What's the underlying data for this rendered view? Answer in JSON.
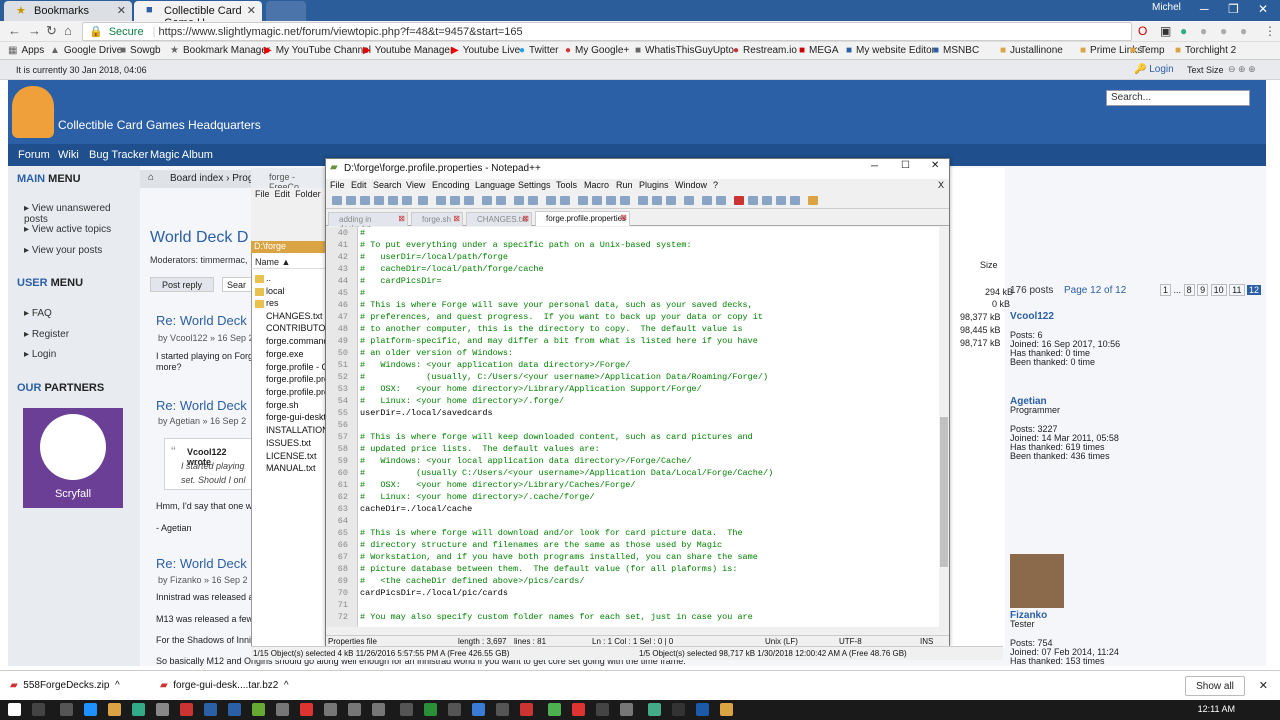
{
  "browser": {
    "tabs": [
      {
        "label": "Bookmarks"
      },
      {
        "label": "Collectible Card Game H"
      }
    ],
    "user": "Michel",
    "url": "https://www.slightlymagic.net/forum/viewtopic.php?f=48&t=9457&start=165",
    "secure_label": "Secure"
  },
  "bookmarks": [
    "Apps",
    "Google Drive",
    "Sowgb",
    "Bookmark Manager",
    "My YouTube Channel",
    "Youtube Manager",
    "Youtube Live",
    "Twitter",
    "My Google+",
    "WhatisThisGuyUpto",
    "Restream.io",
    "MEGA",
    "My website Editor",
    "MSNBC",
    "Justallinone",
    "Prime Links",
    "Temp",
    "Torchlight 2"
  ],
  "forum": {
    "date_line": "It is currently 30 Jan 2018, 04:06",
    "login": "Login",
    "text_size": "Text Size",
    "site_title": "Collectible Card Games Headquarters",
    "search_placeholder": "Search...",
    "nav": [
      "Forum",
      "Wiki",
      "Bug Tracker",
      "Magic Album"
    ],
    "main_menu_title_a": "MAIN",
    "main_menu_title_b": " MENU",
    "main_menu": [
      "View unanswered posts",
      "View active topics",
      "View your posts"
    ],
    "user_menu_title_a": "USER",
    "user_menu_title_b": " MENU",
    "user_menu": [
      "FAQ",
      "Register",
      "Login"
    ],
    "partners_title_a": "OUR",
    "partners_title_b": " PARTNERS",
    "scryfall": "Scryfall",
    "breadcrumb": "Board index",
    "breadcrumb_tail": "Prog",
    "topic_title": "World Deck D",
    "moderators": "Moderators: timmermac,",
    "post_reply": "Post reply",
    "search_short": "Sear",
    "posts_count": "176 posts",
    "pagination": "Page 12 of 12",
    "pages": [
      "1",
      "...",
      "8",
      "9",
      "10",
      "11",
      "12"
    ],
    "posts": [
      {
        "title": "Re: World Deck",
        "meta": "by Vcool122 » 16 Sep 2",
        "body1": "I started playing on Forge",
        "body2": "more?"
      },
      {
        "title": "Re: World Deck D",
        "meta": "by Agetian » 16 Sep 2",
        "quote_author": "Vcool122 wrote",
        "quote1": "I started playing",
        "quote2": "set. Should I onl",
        "body1": "Hmm, I'd say that one will",
        "body2": "- Agetian"
      },
      {
        "title": "Re: World Deck D",
        "meta": "by Fizanko » 16 Sep 2",
        "body1": "Innistrad was released a c",
        "body2": "M13 was released a few m",
        "body3": "For the Shadows of Innistr",
        "body4": "So basically M12 and Origins should go along well enough for an innistrad world if you want to get core set going with the time frame."
      }
    ],
    "users": [
      {
        "name": "Vcool122",
        "rank": "",
        "posts": "Posts: 6",
        "joined": "Joined: 16 Sep 2017, 10:56",
        "thanked": "Has thanked: 0 time",
        "been": "Been thanked: 0 time"
      },
      {
        "name": "Agetian",
        "rank": "Programmer",
        "posts": "Posts: 3227",
        "joined": "Joined: 14 Mar 2011, 05:58",
        "thanked": "Has thanked: 619 times",
        "been": "Been thanked: 436 times"
      },
      {
        "name": "Fizanko",
        "rank": "Tester",
        "posts": "Posts: 754",
        "joined": "Joined: 07 Feb 2014, 11:24",
        "thanked": "Has thanked: 153 times"
      }
    ]
  },
  "explorer": {
    "title": "forge - FreeCo",
    "menu": [
      "File",
      "Edit",
      "Folder"
    ],
    "path": "D:\\forge",
    "col_name": "Name",
    "col_size": "Size",
    "files": [
      "..",
      "local",
      "res",
      "CHANGES.txt",
      "CONTRIBUTOR",
      "forge.command",
      "forge.exe",
      "forge.profile - C",
      "forge.profile.pro",
      "forge.profile.pro",
      "forge.sh",
      "forge-gui-deskto",
      "INSTALLATION",
      "ISSUES.txt",
      "LICENSE.txt",
      "MANUAL.txt"
    ],
    "sizes": [
      "294 kB",
      "0 kB",
      "98,377 kB",
      "98,445 kB",
      "98,717 kB"
    ],
    "status_left": "1/15 Object(s) selected   4 kB  11/26/2016 5:57:55 PM  A   (Free 426.55 GB)",
    "status_right": "1/5 Object(s) selected   98,717 kB  1/30/2018 12:00:42 AM  A   (Free 48.76 GB)"
  },
  "notepad": {
    "title": "D:\\forge\\forge.profile.properties - Notepad++",
    "menu": [
      "File",
      "Edit",
      "Search",
      "View",
      "Encoding",
      "Language",
      "Settings",
      "Tools",
      "Macro",
      "Run",
      "Plugins",
      "Window",
      "?"
    ],
    "tabs": [
      "adding in decks.txt",
      "forge.sh",
      "CHANGES.txt",
      "forge.profile.properties"
    ],
    "lines": [
      {
        "n": "40",
        "t": "#"
      },
      {
        "n": "41",
        "t": "# To put everything under a specific path on a Unix-based system:"
      },
      {
        "n": "42",
        "t": "#   userDir=/local/path/forge"
      },
      {
        "n": "43",
        "t": "#   cacheDir=/local/path/forge/cache"
      },
      {
        "n": "44",
        "t": "#   cardPicsDir="
      },
      {
        "n": "45",
        "t": "#"
      },
      {
        "n": "46",
        "t": "# This is where Forge will save your personal data, such as your saved decks,"
      },
      {
        "n": "47",
        "t": "# preferences, and quest progress.  If you want to back up your data or copy it"
      },
      {
        "n": "48",
        "t": "# to another computer, this is the directory to copy.  The default value is"
      },
      {
        "n": "49",
        "t": "# platform-specific, and may differ a bit from what is listed here if you have"
      },
      {
        "n": "50",
        "t": "# an older version of Windows:"
      },
      {
        "n": "51",
        "t": "#   Windows: <your application data directory>/Forge/"
      },
      {
        "n": "52",
        "t": "#            (usually, C:/Users/<your username>/Application Data/Roaming/Forge/)"
      },
      {
        "n": "53",
        "t": "#   OSX:   <your home directory>/Library/Application Support/Forge/"
      },
      {
        "n": "54",
        "t": "#   Linux: <your home directory>/.forge/"
      },
      {
        "n": "55",
        "t": "userDir=./local/savedcards"
      },
      {
        "n": "56",
        "t": ""
      },
      {
        "n": "57",
        "t": "# This is where forge will keep downloaded content, such as card pictures and"
      },
      {
        "n": "58",
        "t": "# updated price lists.  The default values are:"
      },
      {
        "n": "59",
        "t": "#   Windows: <your local application data directory>/Forge/Cache/"
      },
      {
        "n": "60",
        "t": "#          (usually C:/Users/<your username>/Application Data/Local/Forge/Cache/)"
      },
      {
        "n": "61",
        "t": "#   OSX:   <your home directory>/Library/Caches/Forge/"
      },
      {
        "n": "62",
        "t": "#   Linux: <your home directory>/.cache/forge/"
      },
      {
        "n": "63",
        "t": "cacheDir=./local/cache"
      },
      {
        "n": "64",
        "t": ""
      },
      {
        "n": "65",
        "t": "# This is where forge will download and/or look for card picture data.  The"
      },
      {
        "n": "66",
        "t": "# directory structure and filenames are the same as those used by Magic"
      },
      {
        "n": "67",
        "t": "# Workstation, and if you have both programs installed, you can share the same"
      },
      {
        "n": "68",
        "t": "# picture database between them.  The default value (for all plaforms) is:"
      },
      {
        "n": "69",
        "t": "#   <the cacheDir defined above>/pics/cards/"
      },
      {
        "n": "70",
        "t": "cardPicsDir=./local/pic/cards"
      },
      {
        "n": "71",
        "t": ""
      },
      {
        "n": "72",
        "t": "# You may also specify custom folder names for each set, just in case you are"
      }
    ],
    "status": {
      "type": "Properties file",
      "length": "length : 3,697",
      "lines": "lines : 81",
      "pos": "Ln : 1    Col : 1    Sel : 0 | 0",
      "eol": "Unix (LF)",
      "enc": "UTF-8",
      "ins": "INS"
    }
  },
  "downloads": [
    {
      "name": "558ForgeDecks.zip"
    },
    {
      "name": "forge-gui-desk....tar.bz2"
    }
  ],
  "show_all": "Show all",
  "clock": "12:11 AM"
}
